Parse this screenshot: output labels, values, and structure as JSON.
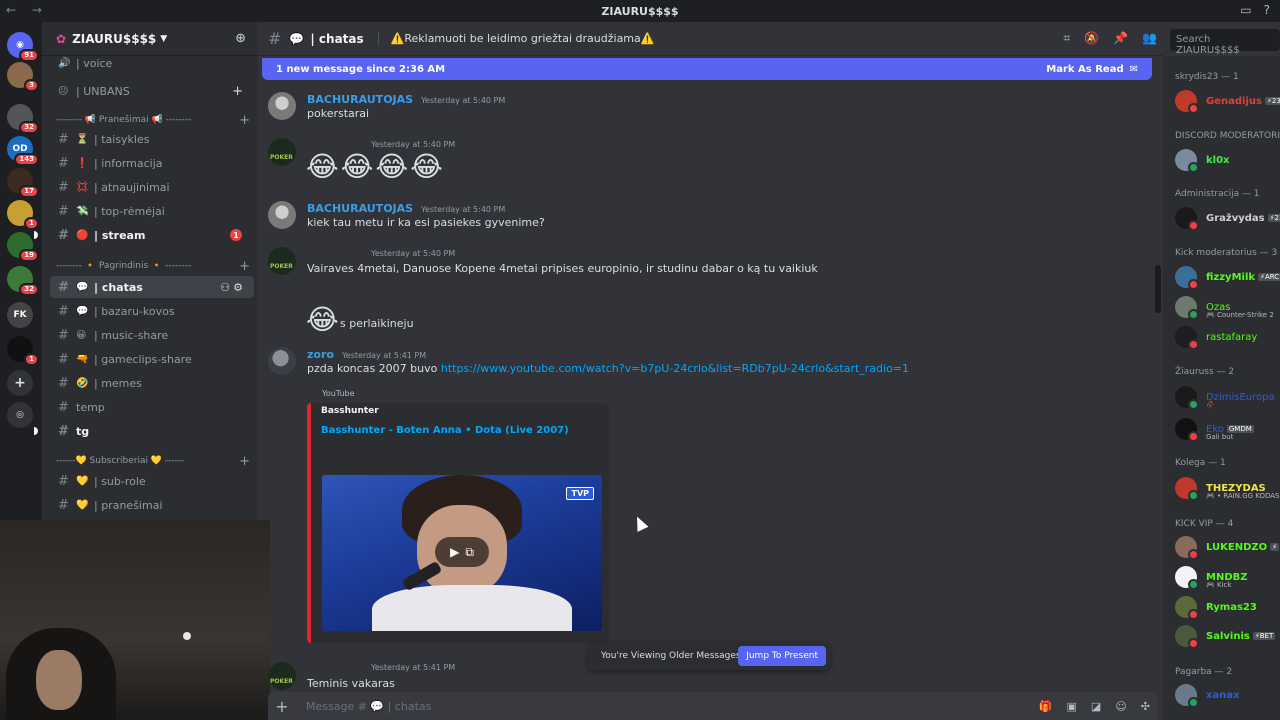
{
  "titlebar": {
    "title": "ZIAURU$$$$",
    "nav": "← →"
  },
  "server": {
    "name": "ZIAURU$$$$"
  },
  "rail": {
    "badges": [
      "91",
      "3",
      "32",
      "143",
      "17",
      "1",
      "19",
      "32",
      "1"
    ]
  },
  "sidebar": {
    "top_partial": "| voice",
    "unbans_cat": "| UNBANS",
    "cat_pranesimai": "-------- 📢 Pranešimai 📢 --------",
    "cat_pagrindinis": "-------- 🔸 Pagrindinis 🔸 --------",
    "cat_subscriberiai": "------💛 Subscriberiai 💛 ------",
    "channels_pranesimai": [
      {
        "emoji": "⏳",
        "name": "| taisykles"
      },
      {
        "emoji": "❗",
        "name": "| informacija"
      },
      {
        "emoji": "💢",
        "name": "| atnaujinimai"
      },
      {
        "emoji": "💸",
        "name": "| top-rėmėjai"
      },
      {
        "emoji": "🔴",
        "name": "| stream",
        "mention": "1"
      }
    ],
    "channels_pagrindinis": [
      {
        "emoji": "💬",
        "name": "| chatas"
      },
      {
        "emoji": "💬",
        "name": "| bazaru-kovos"
      },
      {
        "emoji": "😀",
        "name": "| music-share"
      },
      {
        "emoji": "🔫",
        "name": "| gameclips-share"
      },
      {
        "emoji": "🤣",
        "name": "| memes"
      },
      {
        "emoji": "",
        "name": "temp"
      },
      {
        "emoji": "",
        "name": "tg"
      }
    ],
    "channels_subs": [
      {
        "emoji": "💛",
        "name": "| sub-role"
      },
      {
        "emoji": "💛",
        "name": "| pranešimai"
      }
    ]
  },
  "chat": {
    "channel": "| chatas",
    "topic": "⚠️Reklamuoti be leidimo griežtai draudžiama⚠️",
    "search_placeholder": "Search ZIAURU$$$$",
    "new_bar": "1 new message since 2:36 AM",
    "mark_read": "Mark As Read",
    "messages": [
      {
        "author": "BACHURAUTOJAS",
        "time": "Yesterday at 5:40 PM",
        "text": "pokerstarai"
      },
      {
        "author": "",
        "time": "Yesterday at 5:40 PM",
        "text": "😂😂😂😂"
      },
      {
        "author": "BACHURAUTOJAS",
        "time": "Yesterday at 5:40 PM",
        "text": "kiek tau metu ir ka esi pasiekes gyvenime?"
      },
      {
        "author": "",
        "time": "Yesterday at 5:40 PM",
        "text": "Vairaves 4metai, Danuose Kopene 4metai pripises europinio, ir studinu dabar o ką tu vaikiuk"
      },
      {
        "author": "",
        "time": "",
        "text": "s perlaikineju"
      },
      {
        "author": "zoro",
        "time": "Yesterday at 5:41 PM",
        "text": "pzda koncas 2007 buvo",
        "link": "https://www.youtube.com/watch?v=b7pU-24crlo&list=RDb7pU-24crlo&start_radio=1"
      },
      {
        "author": "",
        "time": "Yesterday at 5:41 PM",
        "text": "Teminis vakaras"
      }
    ],
    "embed": {
      "provider": "YouTube",
      "author": "Basshunter",
      "title": "Basshunter - Boten Anna • Dota (Live 2007)",
      "badge": "TVP"
    },
    "older_text": "You're Viewing Older Messages",
    "jump": "Jump To Present",
    "composer_placeholder": "Message # 💬 | chatas"
  },
  "members": {
    "groups": [
      {
        "title": "skrydis23 — 1",
        "users": [
          {
            "name": "Genadijus",
            "color": "#e0403a",
            "tag": "⚡23"
          }
        ]
      },
      {
        "title": "DISCORD MODERATORIAI",
        "users": [
          {
            "name": "kl0x",
            "color": "#3ef04a"
          }
        ]
      },
      {
        "title": "Administracija — 1",
        "users": [
          {
            "name": "Gražvydas",
            "color": "#d0d0d0",
            "tag": "⚡23"
          }
        ]
      },
      {
        "title": "Kick moderatorius — 3",
        "users": [
          {
            "name": "fizzyMilk",
            "color": "#53fc18",
            "tag": "⚡ARC"
          },
          {
            "name": "Ozas",
            "color": "#53fc18",
            "sub": "🎮 Counter-Strike 2"
          },
          {
            "name": "rastafaray",
            "color": "#53fc18"
          }
        ]
      },
      {
        "title": "Žiauruss — 2",
        "users": [
          {
            "name": "DzimisEuropa",
            "color": "#2f5bd8",
            "sub": "🥀"
          },
          {
            "name": "Eko",
            "color": "#2f5bd8",
            "tag": "GMDM",
            "sub": "Gali but"
          }
        ]
      },
      {
        "title": "Kolega — 1",
        "users": [
          {
            "name": "THEZYDAS",
            "color": "#f0e64a",
            "sub": "🎮 • RAIN.GG KODAS"
          }
        ]
      },
      {
        "title": "KICK VIP — 4",
        "users": [
          {
            "name": "LUKENDZO",
            "color": "#53fc18",
            "tag": "⚡"
          },
          {
            "name": "MNDBZ",
            "color": "#53fc18",
            "sub": "🎮 Kick"
          },
          {
            "name": "Rymas23",
            "color": "#53fc18"
          },
          {
            "name": "Salvinis",
            "color": "#53fc18",
            "tag": "⚡BET"
          }
        ]
      },
      {
        "title": "Pagarba — 2",
        "users": [
          {
            "name": "xanax",
            "color": "#2f5bd8"
          }
        ]
      }
    ]
  }
}
